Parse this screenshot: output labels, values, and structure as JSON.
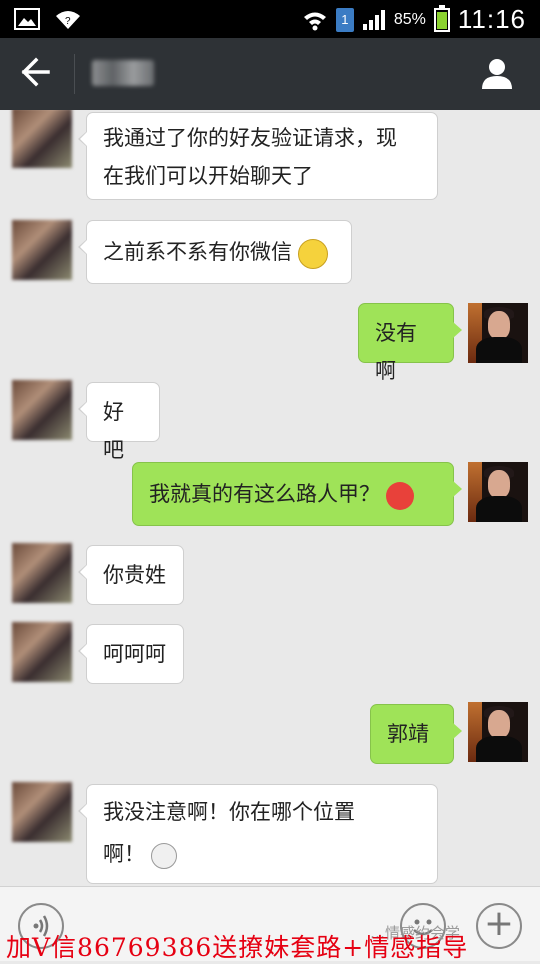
{
  "status_bar": {
    "sim_label": "1",
    "battery_percent": "85%",
    "battery_level": 0.85,
    "time": "11:16"
  },
  "header": {
    "back_icon": "arrow-left-icon",
    "contact_name": "",
    "profile_icon": "person-icon"
  },
  "messages": [
    {
      "side": "left",
      "text_line1": "我通过了你的好友验证请求，现",
      "text_line2": "在我们可以开始聊天了"
    },
    {
      "side": "left",
      "text": "之前系不系有你微信",
      "emoji": "dizzy-face-emoji"
    },
    {
      "side": "right",
      "text": "没有啊"
    },
    {
      "side": "left",
      "text": "好吧"
    },
    {
      "side": "right",
      "text": "我就真的有这么路人甲？",
      "emoji": "angry-face-emoji"
    },
    {
      "side": "left",
      "text": "你贵姓"
    },
    {
      "side": "left",
      "text": "呵呵呵"
    },
    {
      "side": "right",
      "text": "郭靖"
    },
    {
      "side": "left",
      "text_line1": "我没注意啊！你在哪个位置",
      "text_line2": "啊！",
      "emoji": "skull-emoji"
    }
  ],
  "input_bar": {
    "voice_icon": "voice-icon",
    "emoji_icon": "smiley-icon",
    "plus_icon": "plus-icon",
    "plus_label": "+"
  },
  "overlay": {
    "watermark": "…情感约会学",
    "promo_text": "加V信86769386送撩妹套路+情感指导",
    "promo_color": "#e60012"
  },
  "colors": {
    "outgoing_bubble": "#9fe358",
    "incoming_bubble": "#ffffff",
    "titlebar": "#2e3236",
    "chat_background": "#e9e9e9"
  }
}
